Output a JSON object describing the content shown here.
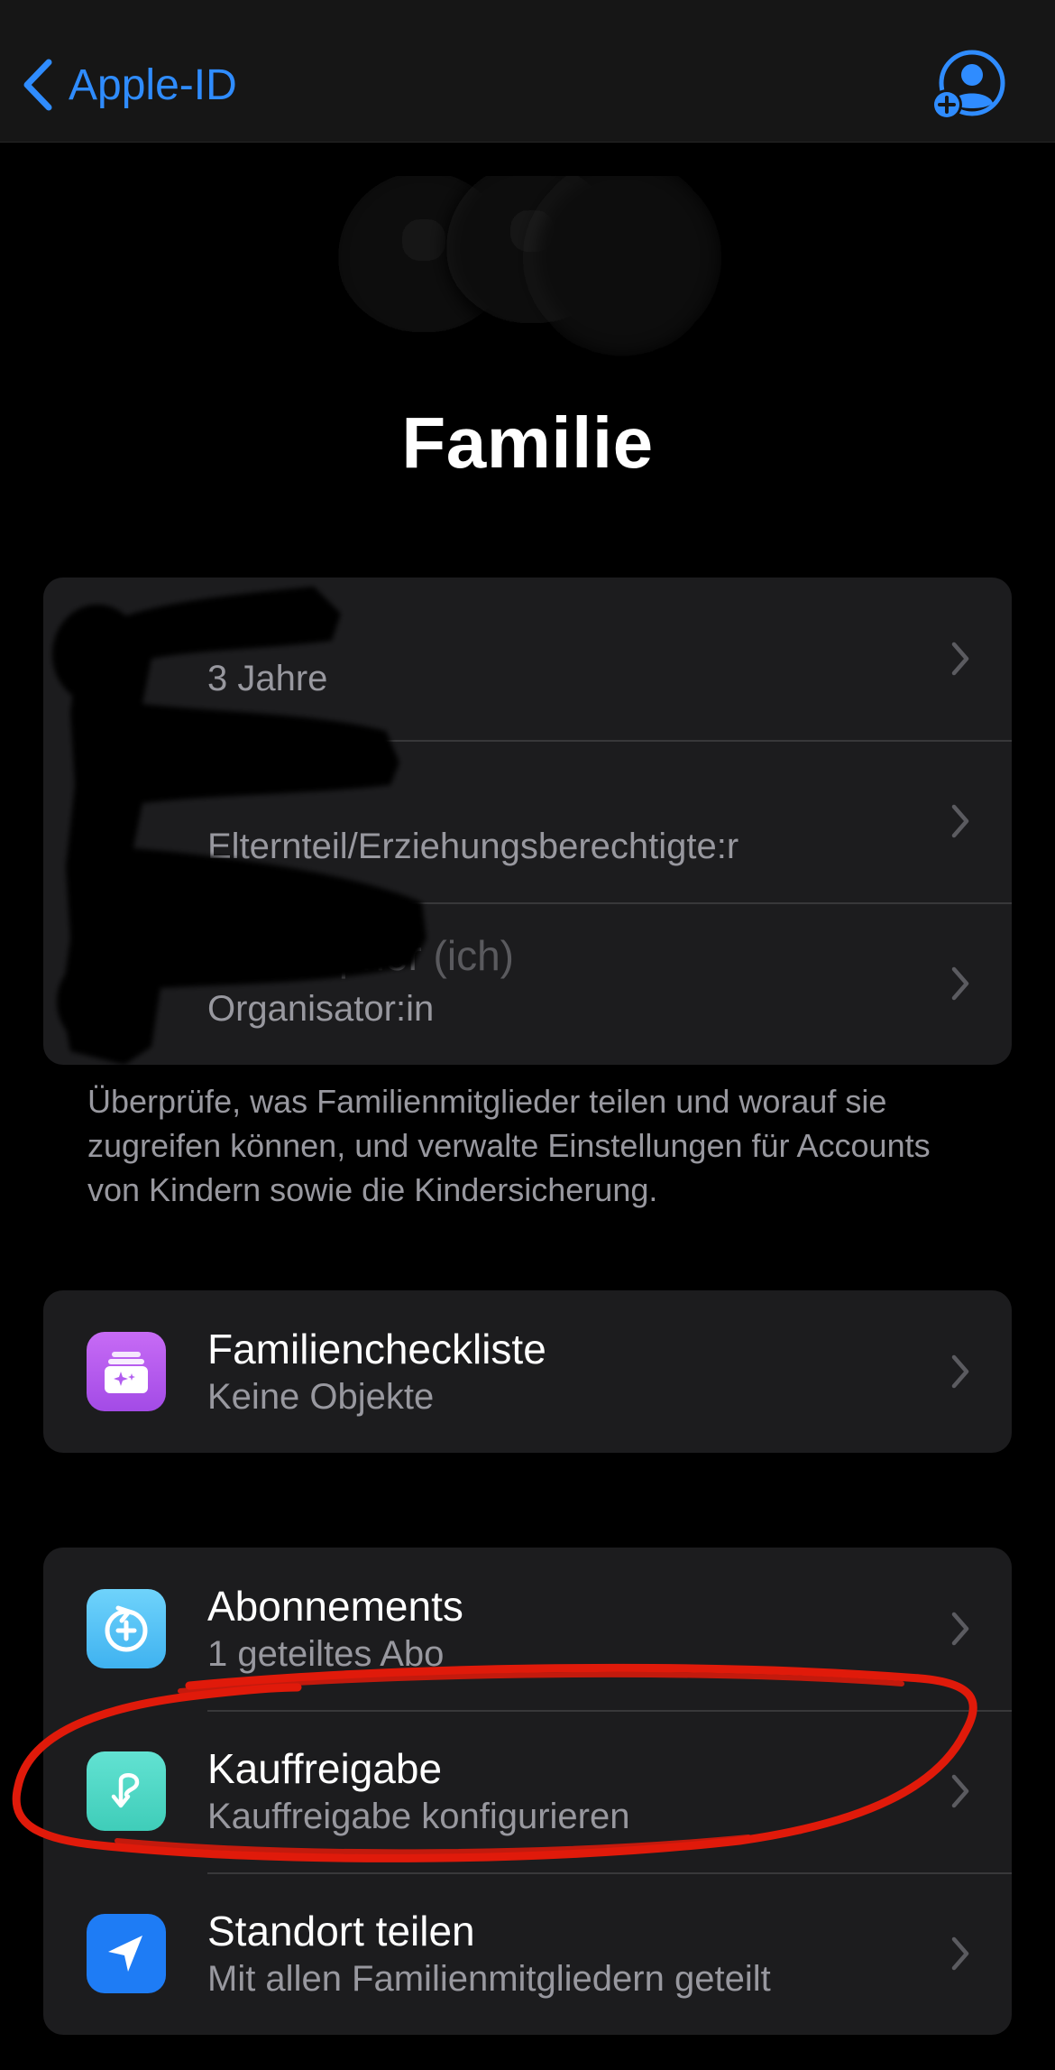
{
  "nav": {
    "back_label": "Apple-ID"
  },
  "page": {
    "title": "Familie"
  },
  "members": [
    {
      "name": "",
      "subtitle": "3 Jahre"
    },
    {
      "name": "",
      "subtitle": "Elternteil/Erziehungsberechtigte:r"
    },
    {
      "name": "Christopher (ich)",
      "subtitle": "Organisator:in"
    }
  ],
  "members_footer": "Überprüfe, was Familienmitglieder teilen und worauf sie zugreifen können, und verwalte Einstellungen für Accounts von Kindern sowie die Kindersicherung.",
  "checklist": {
    "title": "Familiencheckliste",
    "subtitle": "Keine Objekte",
    "icon": "family-checklist-icon",
    "color": "#b25cf0"
  },
  "services": [
    {
      "title": "Abonnements",
      "subtitle": "1 geteiltes Abo",
      "icon": "subscriptions-icon",
      "color": "#54c6f5"
    },
    {
      "title": "Kauffreigabe",
      "subtitle": "Kauffreigabe konfigurieren",
      "icon": "purchase-sharing-icon",
      "color": "#4fd9c7"
    },
    {
      "title": "Standort teilen",
      "subtitle": "Mit allen Familienmitgliedern geteilt",
      "icon": "location-arrow-icon",
      "color": "#1e7cf5"
    }
  ],
  "colors": {
    "accent": "#2f8cff",
    "annotation": "#e01a0a",
    "card": "#1c1c1e",
    "secondary_text": "#98989f"
  }
}
